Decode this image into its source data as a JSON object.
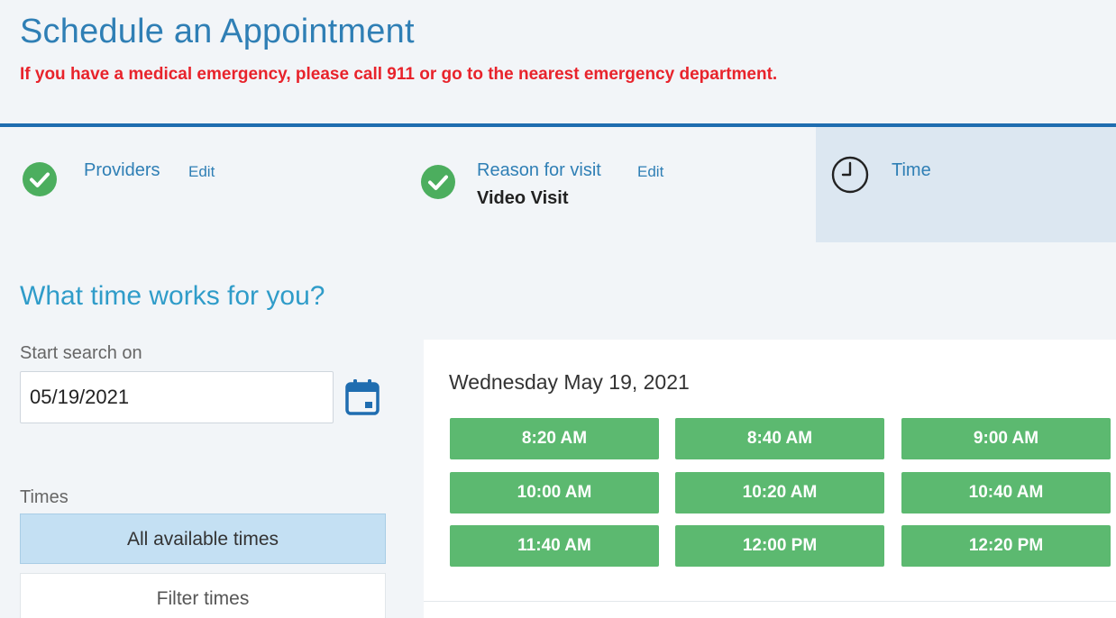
{
  "header": {
    "title": "Schedule an Appointment",
    "emergency_notice": "If you have a medical emergency, please call 911 or go to the nearest emergency department."
  },
  "steps": [
    {
      "label": "Providers",
      "edit": "Edit",
      "value": "",
      "status": "complete"
    },
    {
      "label": "Reason for visit",
      "edit": "Edit",
      "value": "Video Visit",
      "status": "complete"
    },
    {
      "label": "Time",
      "edit": "",
      "value": "",
      "status": "active"
    }
  ],
  "time_section": {
    "question": "What time works for you?",
    "start_label": "Start search on",
    "start_date": "05/19/2021",
    "times_label": "Times",
    "all_times": "All available times",
    "filter_times": "Filter times"
  },
  "availability": {
    "day": "Wednesday May 19, 2021",
    "slots": [
      "8:20 AM",
      "8:40 AM",
      "9:00 AM",
      "10:00 AM",
      "10:20 AM",
      "10:40 AM",
      "11:40 AM",
      "12:00 PM",
      "12:20 PM"
    ]
  },
  "colors": {
    "title": "#2f7fb5",
    "emergency": "#e8232b",
    "check": "#4cae5e",
    "slot": "#5cb970",
    "active_step": "#dce7f1"
  },
  "icons": {
    "step_complete": "check-circle-icon",
    "step_active": "clock-icon",
    "date_picker": "calendar-icon"
  }
}
